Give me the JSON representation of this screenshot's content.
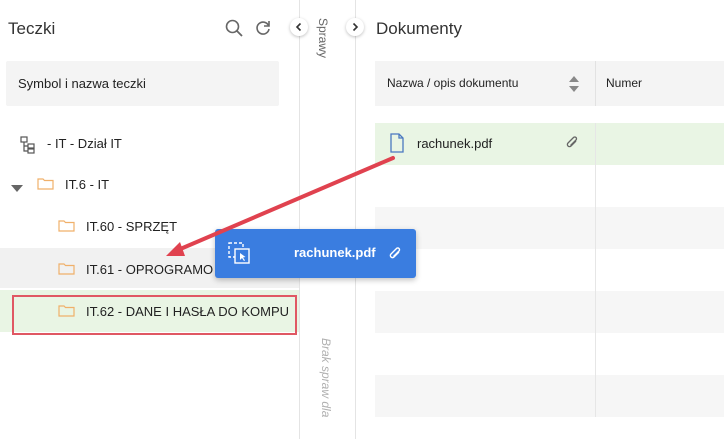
{
  "left_panel": {
    "title": "Teczki",
    "column_header": "Symbol i nazwa teczki",
    "tree": [
      {
        "label": "- IT - Dział IT"
      },
      {
        "label": "IT.6 - IT"
      },
      {
        "label": "IT.60 - SPRZĘT"
      },
      {
        "label": "IT.61 - OPROGRAMO"
      },
      {
        "label": "IT.62 - DANE I HASŁA DO KOMPU"
      }
    ]
  },
  "middle_strip": {
    "sprawy_label": "Sprawy",
    "empty_label": "Brak spraw dla"
  },
  "right_panel": {
    "title": "Dokumenty",
    "column_name": "Nazwa / opis dokumentu",
    "column_number": "Numer",
    "document": {
      "name": "rachunek.pdf"
    }
  },
  "drag_ghost": {
    "name": "rachunek.pdf"
  },
  "colors": {
    "accent_blue": "#3a7de0",
    "highlight_green": "#e9f5e4",
    "arrow_red": "#e0424f",
    "folder_orange": "#f0b06a"
  }
}
